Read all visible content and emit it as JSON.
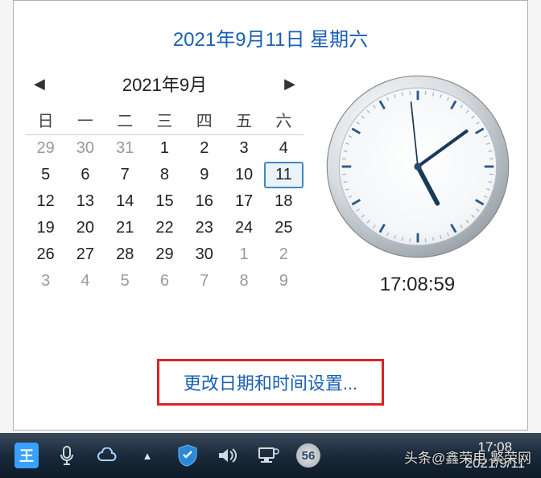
{
  "header": {
    "full_date": "2021年9月11日 星期六"
  },
  "calendar": {
    "month_label": "2021年9月",
    "prev": "◀",
    "next": "▶",
    "weekdays": [
      "日",
      "一",
      "二",
      "三",
      "四",
      "五",
      "六"
    ],
    "weeks": [
      [
        {
          "n": "29",
          "o": true
        },
        {
          "n": "30",
          "o": true
        },
        {
          "n": "31",
          "o": true
        },
        {
          "n": "1"
        },
        {
          "n": "2"
        },
        {
          "n": "3"
        },
        {
          "n": "4"
        }
      ],
      [
        {
          "n": "5"
        },
        {
          "n": "6"
        },
        {
          "n": "7"
        },
        {
          "n": "8"
        },
        {
          "n": "9"
        },
        {
          "n": "10"
        },
        {
          "n": "11",
          "sel": true
        }
      ],
      [
        {
          "n": "12"
        },
        {
          "n": "13"
        },
        {
          "n": "14"
        },
        {
          "n": "15"
        },
        {
          "n": "16"
        },
        {
          "n": "17"
        },
        {
          "n": "18"
        }
      ],
      [
        {
          "n": "19"
        },
        {
          "n": "20"
        },
        {
          "n": "21"
        },
        {
          "n": "22"
        },
        {
          "n": "23"
        },
        {
          "n": "24"
        },
        {
          "n": "25"
        }
      ],
      [
        {
          "n": "26"
        },
        {
          "n": "27"
        },
        {
          "n": "28"
        },
        {
          "n": "29"
        },
        {
          "n": "30"
        },
        {
          "n": "1",
          "o": true
        },
        {
          "n": "2",
          "o": true
        }
      ],
      [
        {
          "n": "3",
          "o": true
        },
        {
          "n": "4",
          "o": true
        },
        {
          "n": "5",
          "o": true
        },
        {
          "n": "6",
          "o": true
        },
        {
          "n": "7",
          "o": true
        },
        {
          "n": "8",
          "o": true
        },
        {
          "n": "9",
          "o": true
        }
      ]
    ]
  },
  "clock": {
    "digital": "17:08:59",
    "hour_angle": 152,
    "minute_angle": 54,
    "second_angle": 354
  },
  "settings": {
    "link_text": "更改日期和时间设置..."
  },
  "taskbar": {
    "time": "17:08",
    "date": "2021/9/11"
  },
  "watermark": {
    "right": "头条@鑫荣电  繁荣网",
    "left": ""
  },
  "icons": {
    "wang": "王",
    "mic": "🎤",
    "cloud": "☁",
    "up": "▲",
    "shield": "🛡",
    "vol": "🔊",
    "net": "🖧",
    "badge": "56"
  }
}
